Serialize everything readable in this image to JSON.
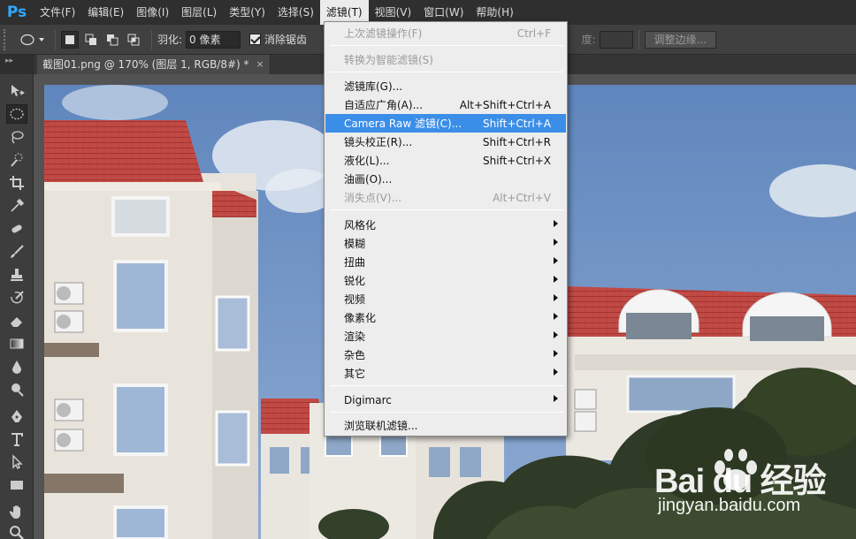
{
  "app": {
    "logo": "Ps"
  },
  "menubar": {
    "items": [
      {
        "label": "文件(F)"
      },
      {
        "label": "编辑(E)"
      },
      {
        "label": "图像(I)"
      },
      {
        "label": "图层(L)"
      },
      {
        "label": "类型(Y)"
      },
      {
        "label": "选择(S)"
      },
      {
        "label": "滤镜(T)",
        "active": true
      },
      {
        "label": "视图(V)"
      },
      {
        "label": "窗口(W)"
      },
      {
        "label": "帮助(H)"
      }
    ]
  },
  "options": {
    "feather_label": "羽化:",
    "feather_value": "0 像素",
    "antialias_label": "消除锯齿",
    "antialias_checked": true,
    "density_label_partial": "度:",
    "refine_edge_label": "调整边缘..."
  },
  "document": {
    "tab_title": "截图01.png @ 170% (图层 1, RGB/8#) *",
    "close_glyph": "×"
  },
  "filter_menu": {
    "items": [
      {
        "label": "上次滤镜操作(F)",
        "shortcut": "Ctrl+F",
        "disabled": true
      },
      {
        "label": "转换为智能滤镜(S)",
        "disabled": true
      },
      {
        "label": "滤镜库(G)..."
      },
      {
        "label": "自适应广角(A)...",
        "shortcut": "Alt+Shift+Ctrl+A"
      },
      {
        "label": "Camera Raw 滤镜(C)...",
        "shortcut": "Shift+Ctrl+A",
        "highlighted": true
      },
      {
        "label": "镜头校正(R)...",
        "shortcut": "Shift+Ctrl+R"
      },
      {
        "label": "液化(L)...",
        "shortcut": "Shift+Ctrl+X"
      },
      {
        "label": "油画(O)..."
      },
      {
        "label": "消失点(V)...",
        "shortcut": "Alt+Ctrl+V",
        "disabled": true
      },
      {
        "label": "风格化",
        "submenu": true
      },
      {
        "label": "模糊",
        "submenu": true
      },
      {
        "label": "扭曲",
        "submenu": true
      },
      {
        "label": "锐化",
        "submenu": true
      },
      {
        "label": "视频",
        "submenu": true
      },
      {
        "label": "像素化",
        "submenu": true
      },
      {
        "label": "渲染",
        "submenu": true
      },
      {
        "label": "杂色",
        "submenu": true
      },
      {
        "label": "其它",
        "submenu": true
      },
      {
        "label": "Digimarc",
        "submenu": true
      },
      {
        "label": "浏览联机滤镜..."
      }
    ]
  },
  "watermark": {
    "brand": "Bai du 经验",
    "url": "jingyan.baidu.com"
  },
  "colors": {
    "highlight": "#3b8ee8",
    "ps_blue": "#31a8ff",
    "menubar_bg": "#2f2f2f"
  },
  "icons": {
    "tools": [
      "move-icon",
      "elliptical-marquee-icon",
      "lasso-icon",
      "quick-select-icon",
      "crop-icon",
      "eyedropper-icon",
      "spot-healing-icon",
      "brush-icon",
      "clone-stamp-icon",
      "history-brush-icon",
      "eraser-icon",
      "gradient-icon",
      "blur-icon",
      "dodge-icon",
      "pen-icon",
      "type-icon",
      "path-select-icon",
      "rectangle-shape-icon",
      "hand-icon",
      "zoom-icon"
    ]
  }
}
